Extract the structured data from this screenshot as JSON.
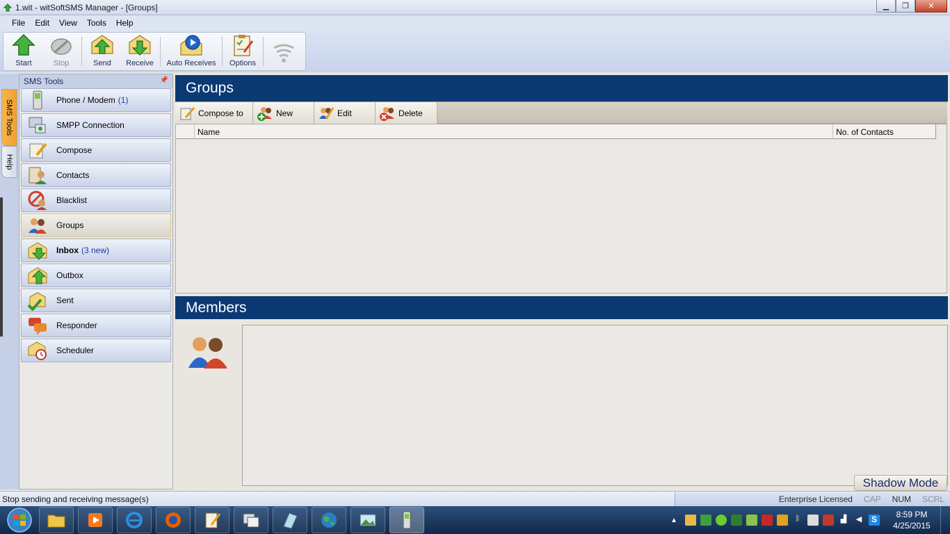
{
  "window": {
    "title": "1.wit - witSoftSMS Manager - [Groups]"
  },
  "menu": [
    "File",
    "Edit",
    "View",
    "Tools",
    "Help"
  ],
  "toolbar": {
    "start": "Start",
    "stop": "Stop",
    "send": "Send",
    "receive": "Receive",
    "auto_receives": "Auto Receives",
    "options": "Options"
  },
  "side_tabs": {
    "sms_tools": "SMS Tools",
    "help": "Help"
  },
  "sms_panel": {
    "header": "SMS Tools",
    "items": [
      {
        "label": "Phone / Modem",
        "count": "(1)"
      },
      {
        "label": "SMPP Connection",
        "count": ""
      },
      {
        "label": "Compose",
        "count": ""
      },
      {
        "label": "Contacts",
        "count": ""
      },
      {
        "label": "Blacklist",
        "count": ""
      },
      {
        "label": "Groups",
        "count": ""
      },
      {
        "label": "Inbox",
        "count": "(3 new)"
      },
      {
        "label": "Outbox",
        "count": ""
      },
      {
        "label": "Sent",
        "count": ""
      },
      {
        "label": "Responder",
        "count": ""
      },
      {
        "label": "Scheduler",
        "count": ""
      }
    ]
  },
  "groups": {
    "title": "Groups",
    "actions": {
      "compose_to": "Compose to",
      "new": "New",
      "edit": "Edit",
      "delete": "Delete"
    },
    "columns": [
      "Name",
      "No. of Contacts"
    ]
  },
  "members": {
    "title": "Members"
  },
  "shadow_mode": "Shadow Mode",
  "status": {
    "message": "Stop sending and receiving message(s)",
    "license": "Enterprise Licensed",
    "cap": "CAP",
    "num": "NUM",
    "scrl": "SCRL"
  },
  "taskbar": {
    "time": "8:59 PM",
    "date": "4/25/2015"
  },
  "colors": {
    "section_header": "#0b3a73",
    "link_count": "#1a3aa8",
    "active_tab": "#f0a030"
  }
}
